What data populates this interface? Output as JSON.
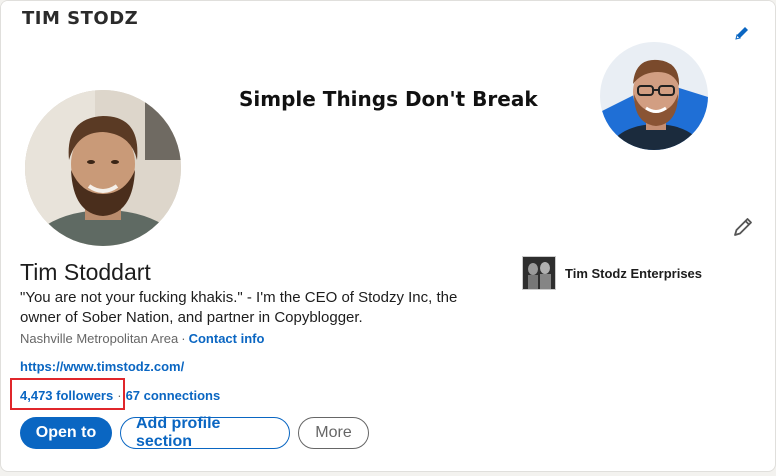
{
  "banner": {
    "brand": "TIM STODZ",
    "tagline": "Simple Things Don't Break",
    "edit_icon": "pencil-icon"
  },
  "profile": {
    "name": "Tim Stoddart",
    "headline": "\"You are not your fucking khakis.\" - I'm the CEO of Stodzy Inc, the owner of Sober Nation, and partner in Copyblogger.",
    "location": "Nashville Metropolitan Area",
    "separator": "·",
    "contact_info": "Contact info",
    "website": "https://www.timstodz.com/",
    "followers": "4,473 followers",
    "connections": "67 connections",
    "edit_icon": "pencil-icon"
  },
  "company": {
    "name": "Tim Stodz Enterprises"
  },
  "actions": {
    "open_to": "Open to",
    "add_section": "Add profile section",
    "more": "More"
  },
  "colors": {
    "primary": "#0a66c2",
    "highlight": "#e0262b"
  }
}
